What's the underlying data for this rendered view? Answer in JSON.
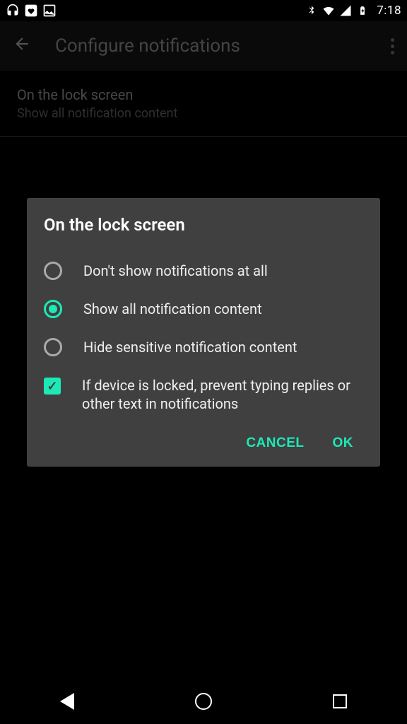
{
  "statusbar": {
    "clock": "7:18"
  },
  "appbar": {
    "title": "Configure notifications"
  },
  "settings": {
    "title": "On the lock screen",
    "subtitle": "Show all notification content"
  },
  "dialog": {
    "title": "On the lock screen",
    "options": [
      "Don't show notifications at all",
      "Show all notification content",
      "Hide sensitive notification content"
    ],
    "checkbox_label": "If device is locked, prevent typing replies or other text in notifications",
    "cancel": "CANCEL",
    "ok": "OK"
  }
}
